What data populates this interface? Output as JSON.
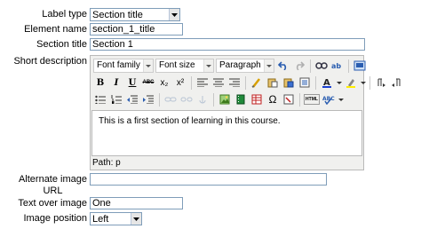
{
  "form": {
    "label_type": {
      "label": "Label type",
      "value": "Section title"
    },
    "element_name": {
      "label": "Element name",
      "value": "section_1_title"
    },
    "section_title": {
      "label": "Section title",
      "value": "Section 1"
    },
    "short_description": {
      "label": "Short description"
    },
    "alternate_image_url": {
      "label_line1": "Alternate image",
      "label_line2": "URL",
      "value": ""
    },
    "text_over_image": {
      "label": "Text over image",
      "value": "One"
    },
    "image_position": {
      "label": "Image position",
      "value": "Left"
    }
  },
  "editor": {
    "font_family": "Font family",
    "font_size": "Font size",
    "format": "Paragraph",
    "content": "This is a first section of learning in this course.",
    "path_label": "Path:",
    "path_value": "p",
    "buttons": {
      "bold": "B",
      "italic": "I",
      "underline": "U",
      "strike": "ABC",
      "sub": "x₂",
      "sup": "x²",
      "html": "HTML",
      "omega": "Ω"
    }
  },
  "colors": {
    "toolbar_bg": "#f0f0ee",
    "field_border": "#7f9db9"
  }
}
